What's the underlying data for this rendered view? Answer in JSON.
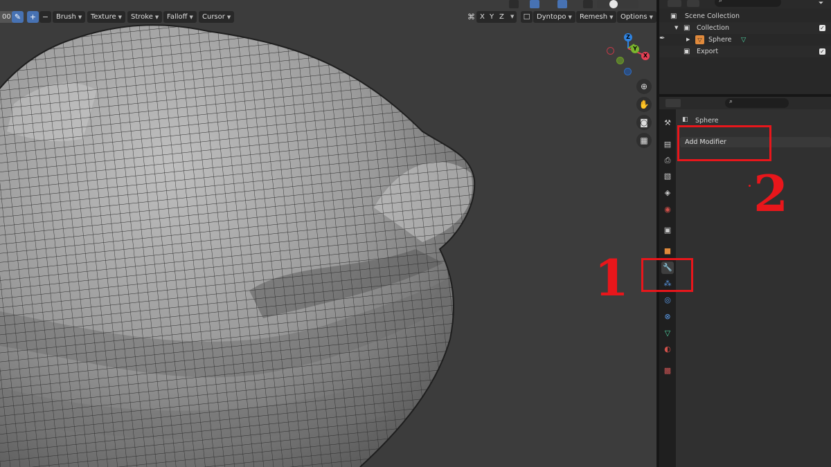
{
  "header": {
    "value_left": "00",
    "brush": "Brush",
    "texture": "Texture",
    "stroke": "Stroke",
    "falloff": "Falloff",
    "cursor": "Cursor",
    "axis_x": "X",
    "axis_y": "Y",
    "axis_z": "Z",
    "dyntopo": "Dyntopo",
    "remesh": "Remesh",
    "options": "Options"
  },
  "gizmo": {
    "z": "Z",
    "y": "Y",
    "x": "X"
  },
  "outliner": {
    "scene_collection": "Scene Collection",
    "collection": "Collection",
    "sphere": "Sphere",
    "export": "Export"
  },
  "properties": {
    "object_name": "Sphere",
    "add_modifier": "Add Modifier",
    "active_tab": "modifiers"
  },
  "annotations": {
    "one": "1",
    "two": "2",
    "color": "#e8161b"
  },
  "icons": [
    "wrench-icon",
    "search-icon",
    "hand-icon",
    "zoom-icon",
    "camera-icon",
    "grid-icon",
    "filter-icon"
  ]
}
